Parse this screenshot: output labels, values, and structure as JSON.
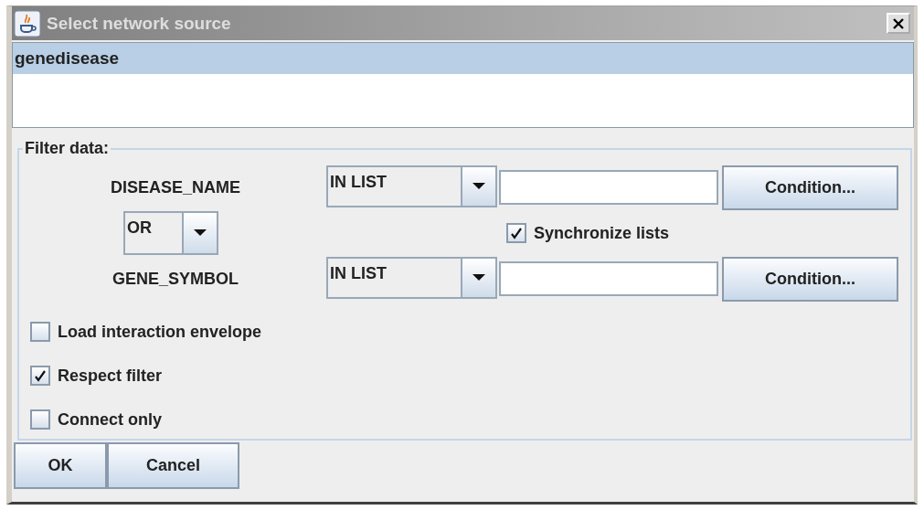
{
  "window": {
    "title": "Select network source"
  },
  "sources": [
    {
      "label": "genedisease",
      "selected": true
    }
  ],
  "filter": {
    "title": "Filter data:",
    "conditions": [
      {
        "field": "DISEASE_NAME",
        "operator": "IN LIST",
        "button": "Condition..."
      },
      {
        "field": "GENE_SYMBOL",
        "operator": "IN LIST",
        "button": "Condition..."
      }
    ],
    "combiner": "OR",
    "synchronize": {
      "label": "Synchronize lists",
      "checked": true
    }
  },
  "options": [
    {
      "label": "Load interaction envelope",
      "checked": false
    },
    {
      "label": "Respect filter",
      "checked": true
    },
    {
      "label": "Connect only",
      "checked": false
    }
  ],
  "buttons": [
    "OK",
    "Cancel"
  ]
}
